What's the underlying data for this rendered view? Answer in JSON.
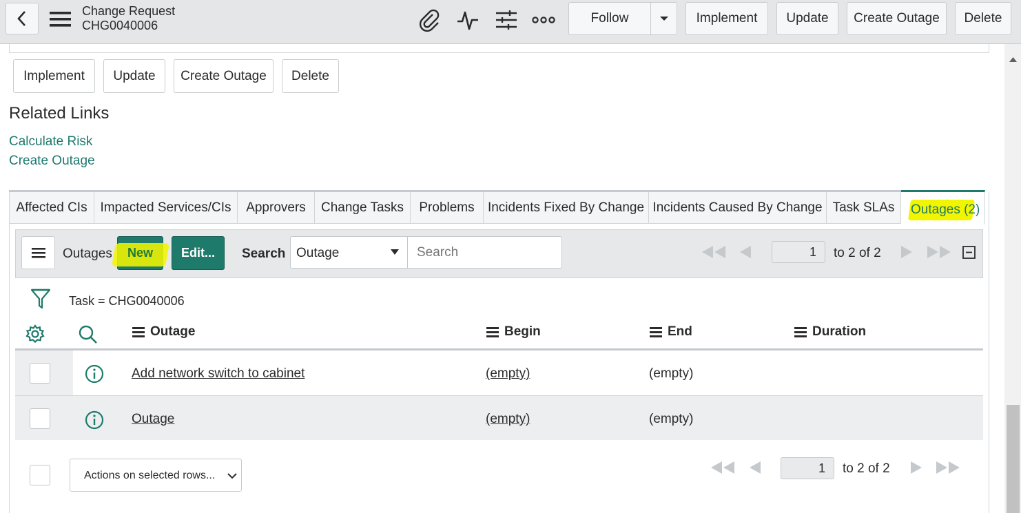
{
  "header": {
    "title": "Change Request",
    "number": "CHG0040006",
    "follow_label": "Follow",
    "buttons": [
      "Implement",
      "Update",
      "Create Outage",
      "Delete"
    ]
  },
  "form_buttons": [
    "Implement",
    "Update",
    "Create Outage",
    "Delete"
  ],
  "related_links": {
    "heading": "Related Links",
    "links": [
      "Calculate Risk",
      "Create Outage"
    ]
  },
  "tabs": [
    "Affected CIs",
    "Impacted Services/CIs",
    "Approvers",
    "Change Tasks",
    "Problems",
    "Incidents Fixed By Change",
    "Incidents Caused By Change",
    "Task SLAs",
    "Outages (2)"
  ],
  "list": {
    "title": "Outages",
    "new_label": "New",
    "edit_label": "Edit...",
    "search_label": "Search",
    "search_field": "Outage",
    "search_placeholder": "Search",
    "page": "1",
    "range": "to 2 of 2",
    "filter": "Task = CHG0040006",
    "columns": [
      "Outage",
      "Begin",
      "End",
      "Duration"
    ],
    "rows": [
      {
        "outage": "Add network switch to cabinet",
        "begin": "(empty)",
        "end": "(empty)",
        "duration": ""
      },
      {
        "outage": "Outage",
        "begin": "(empty)",
        "end": "(empty)",
        "duration": ""
      }
    ],
    "actions_label": "Actions on selected rows...",
    "bottom_page": "1",
    "bottom_range": "to 2 of 2"
  },
  "colors": {
    "accent": "#1e7a6a",
    "link": "#1d7a6f",
    "highlight": "#f2f500"
  }
}
